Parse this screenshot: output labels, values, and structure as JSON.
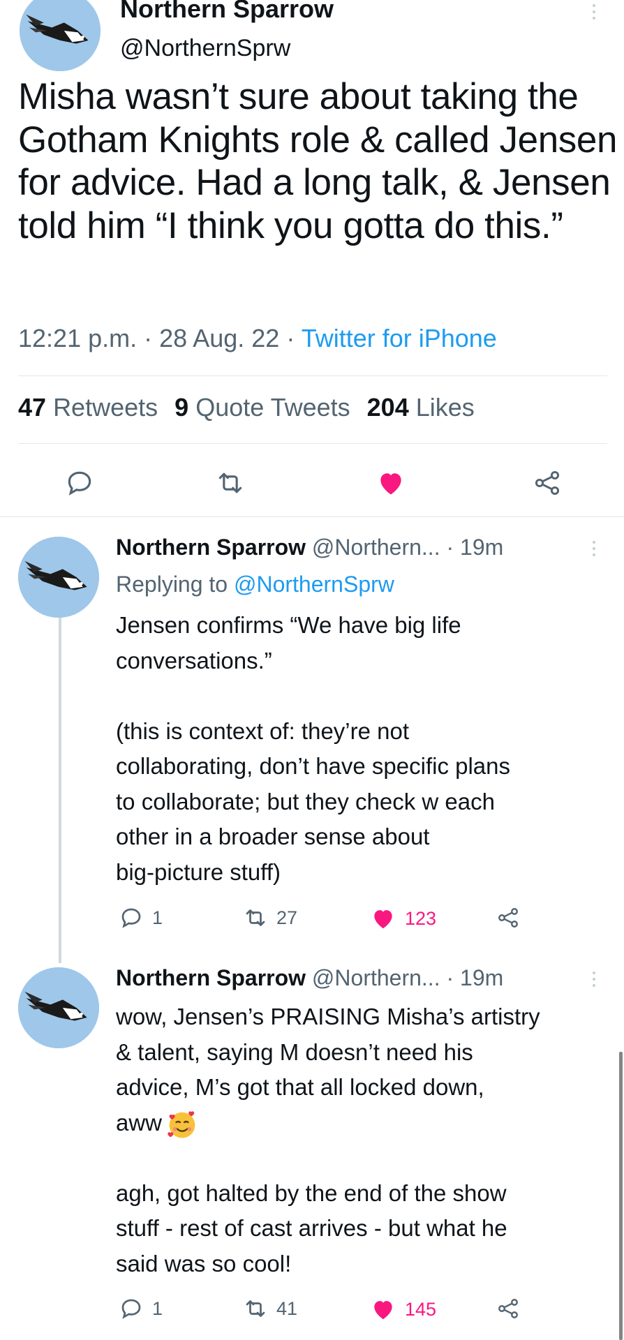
{
  "tweet": {
    "author_name": "Northern Sparrow",
    "author_handle": "@NorthernSprw",
    "avatar_icon": "bird-avatar-icon",
    "text": "Misha wasn’t sure about taking the Gotham Knights role & called Jensen for advice. Had a long talk, & Jensen told him “I think you gotta do this.”",
    "time": "12:21 p.m.",
    "date": "28 Aug. 22",
    "source": "Twitter for iPhone",
    "separator": "·",
    "stats": {
      "retweets_count": "47",
      "retweets_label": "Retweets",
      "quotes_count": "9",
      "quotes_label": "Quote Tweets",
      "likes_count": "204",
      "likes_label": "Likes"
    },
    "actions": [
      "reply-icon",
      "retweet-icon",
      "like-icon",
      "share-icon"
    ],
    "liked": true
  },
  "replies": [
    {
      "author_name": "Northern Sparrow",
      "author_handle": "@Northern...",
      "time": "19m",
      "replying_label": "Replying to",
      "replying_to": "@NorthernSprw",
      "paragraphs": [
        [
          "Jensen confirms “We have big life",
          "conversations.”"
        ],
        [
          "(this is context of: they’re not",
          "collaborating, don’t have specific plans",
          "to collaborate; but they check w each",
          "other in a broader sense about",
          "big-picture stuff)"
        ]
      ],
      "replies_count": "1",
      "retweets_count": "27",
      "likes_count": "123"
    },
    {
      "author_name": "Northern Sparrow",
      "author_handle": "@Northern...",
      "time": "19m",
      "paragraphs": [
        [
          "wow, Jensen’s PRAISING Misha’s artistry",
          "& talent, saying M doesn’t need his",
          "advice, M’s got that all locked down,",
          "aww"
        ],
        [
          "agh, got halted by the end of the show",
          "stuff - rest of cast arrives - but what he",
          "said was so cool!"
        ]
      ],
      "emoji": "smiling-face-with-hearts-emoji",
      "replies_count": "1",
      "retweets_count": "41",
      "likes_count": "145"
    }
  ],
  "colors": {
    "accent": "#1d9bf0",
    "like": "#f91880",
    "secondary_text": "#536471",
    "primary_text": "#0f1419",
    "divider": "#e3e6ea"
  }
}
